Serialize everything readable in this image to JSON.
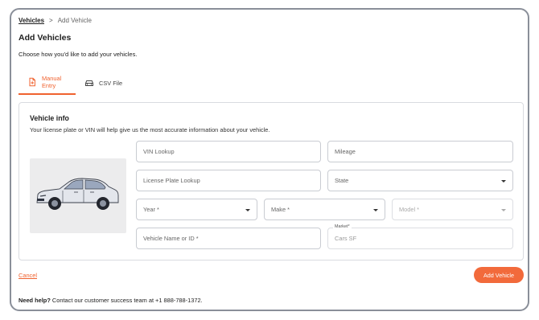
{
  "breadcrumb": {
    "parent": "Vehicles",
    "separator": ">",
    "current": "Add Vehicle"
  },
  "page": {
    "title": "Add Vehicles",
    "subtitle": "Choose how you'd like to add your vehicles."
  },
  "tabs": [
    {
      "label": "Manual Entry",
      "icon": "document-plus-icon",
      "active": true
    },
    {
      "label": "CSV File",
      "icon": "car-icon",
      "active": false
    }
  ],
  "vehicle_info": {
    "title": "Vehicle info",
    "subtitle": "Your license plate or VIN will help give us the most accurate information about your vehicle.",
    "image": "sedan-car-illustration"
  },
  "fields": {
    "vin": {
      "placeholder": "VIN Lookup"
    },
    "mileage": {
      "placeholder": "Mileage"
    },
    "plate": {
      "placeholder": "License Plate Lookup"
    },
    "state": {
      "placeholder": "State"
    },
    "year": {
      "placeholder": "Year *"
    },
    "make": {
      "placeholder": "Make *"
    },
    "model": {
      "placeholder": "Model *"
    },
    "name": {
      "placeholder": "Vehicle Name or ID *"
    },
    "market": {
      "label": "Market*",
      "value": "Cars SF"
    }
  },
  "actions": {
    "cancel": "Cancel",
    "submit": "Add Vehicle"
  },
  "help": {
    "strong": "Need help?",
    "text": " Contact our customer success team at +1 888-788-1372."
  },
  "colors": {
    "accent": "#f0622f",
    "border": "#c9ccd2",
    "panel": "#ececed"
  }
}
